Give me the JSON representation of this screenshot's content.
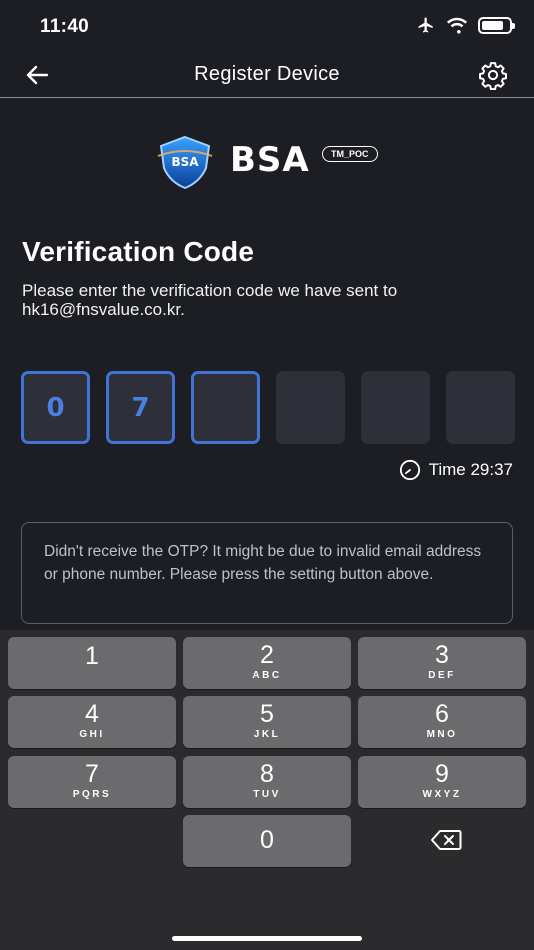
{
  "status_bar": {
    "time": "11:40"
  },
  "nav": {
    "title": "Register Device"
  },
  "logo": {
    "text": "BSA",
    "badge": "TM_POC",
    "shield_text": "BSA"
  },
  "verification": {
    "heading": "Verification Code",
    "instructions": "Please enter the verification code we have sent to hk16@fnsvalue.co.kr."
  },
  "otp": {
    "digits": [
      "0",
      "7",
      "",
      "",
      "",
      ""
    ]
  },
  "timer": {
    "label": "Time 29:37"
  },
  "notice": {
    "text": "Didn't receive the OTP? It might be due to invalid email address or phone number. Please press the setting button above."
  },
  "keypad": {
    "keys": [
      {
        "num": "1",
        "letters": ""
      },
      {
        "num": "2",
        "letters": "ABC"
      },
      {
        "num": "3",
        "letters": "DEF"
      },
      {
        "num": "4",
        "letters": "GHI"
      },
      {
        "num": "5",
        "letters": "JKL"
      },
      {
        "num": "6",
        "letters": "MNO"
      },
      {
        "num": "7",
        "letters": "PQRS"
      },
      {
        "num": "8",
        "letters": "TUV"
      },
      {
        "num": "9",
        "letters": "WXYZ"
      },
      {
        "num": "0",
        "letters": ""
      }
    ]
  },
  "colors": {
    "background": "#1c1e24",
    "accent": "#3f74d6",
    "key": "#6b6b6e"
  }
}
